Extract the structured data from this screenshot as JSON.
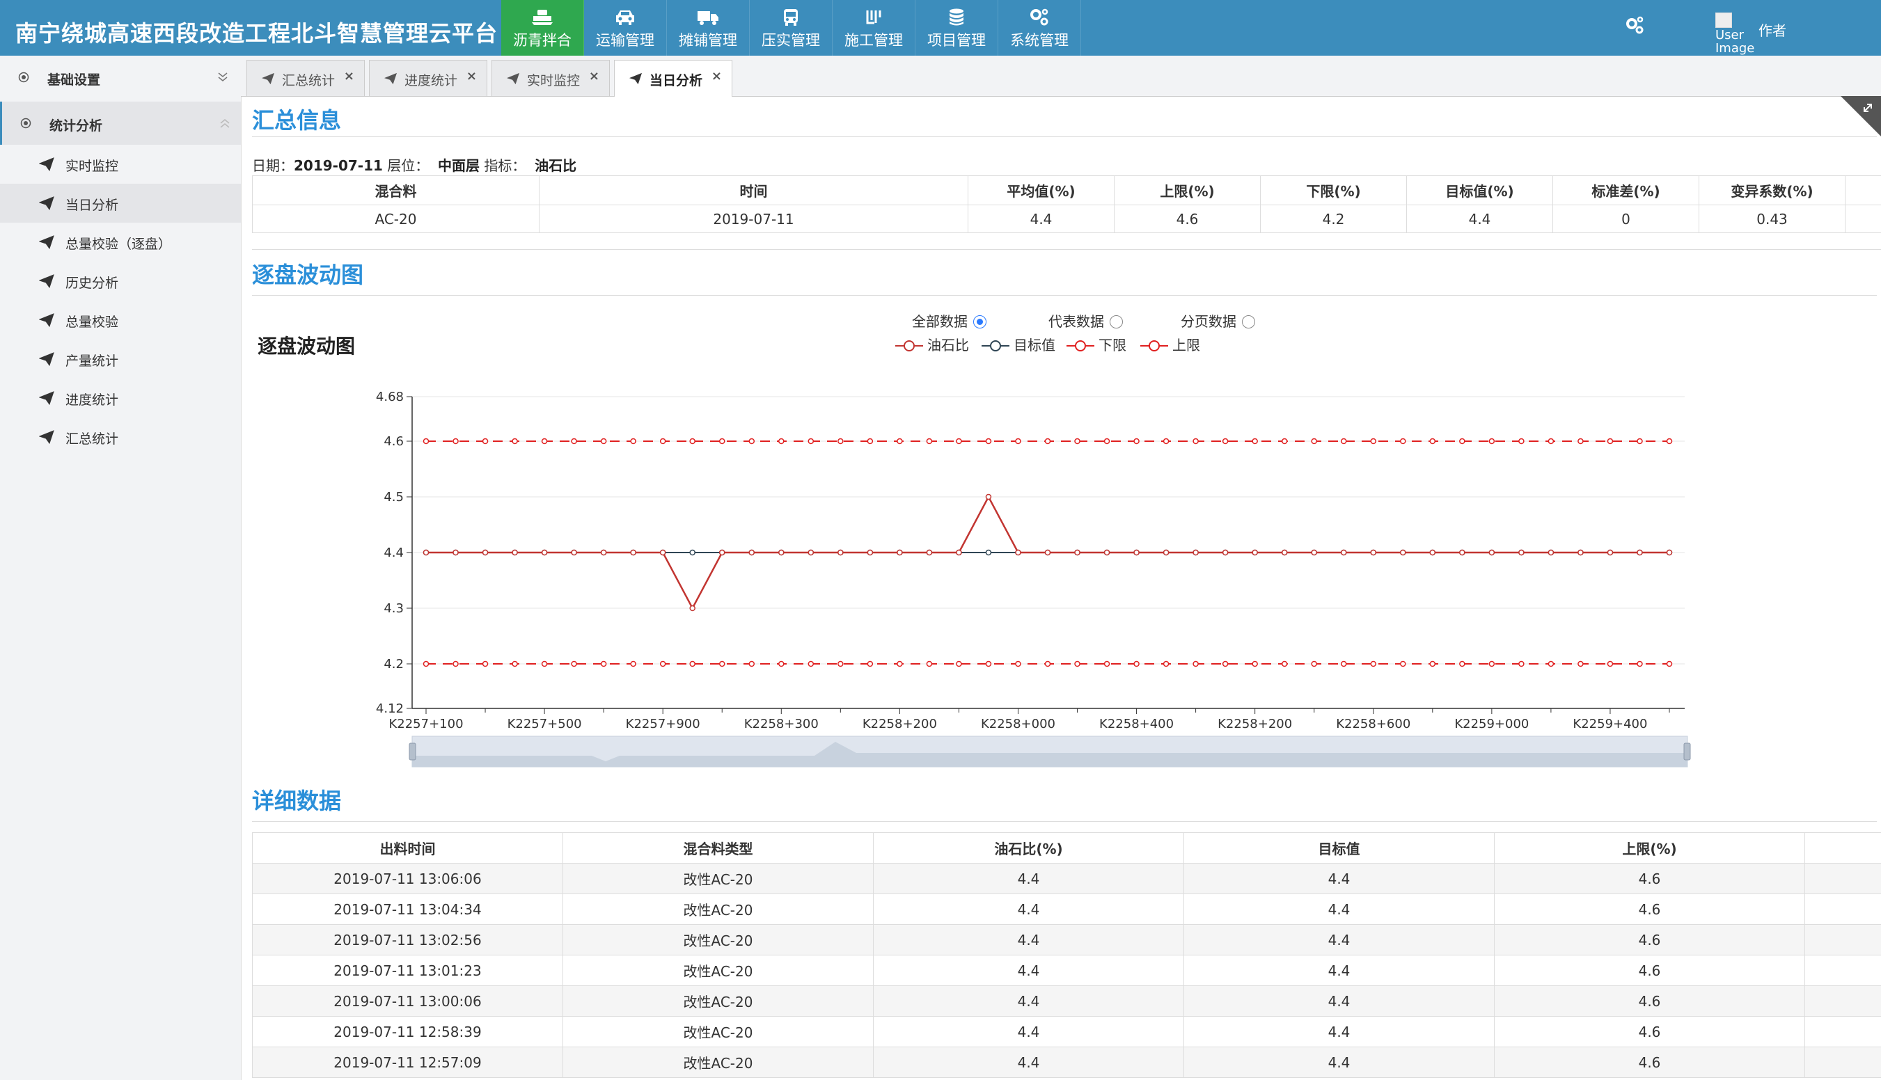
{
  "app": {
    "title": "南宁绕城高速西段改造工程北斗智慧管理云平台",
    "author_label": "作者",
    "user_image_alt": "User Image"
  },
  "nav": [
    {
      "label": "沥青拌合",
      "icon": "plant-icon",
      "active": true
    },
    {
      "label": "运输管理",
      "icon": "car-icon",
      "active": false
    },
    {
      "label": "摊铺管理",
      "icon": "truck-icon",
      "active": false
    },
    {
      "label": "压实管理",
      "icon": "bus-icon",
      "active": false
    },
    {
      "label": "施工管理",
      "icon": "bar-chart-icon",
      "active": false
    },
    {
      "label": "项目管理",
      "icon": "database-icon",
      "active": false
    },
    {
      "label": "系统管理",
      "icon": "gears-icon",
      "active": false
    }
  ],
  "sidebar": {
    "groups": [
      {
        "label": "基础设置",
        "expanded": false
      },
      {
        "label": "统计分析",
        "expanded": true
      }
    ],
    "items": [
      {
        "label": "实时监控"
      },
      {
        "label": "当日分析",
        "active": true
      },
      {
        "label": "总量校验（逐盘）"
      },
      {
        "label": "历史分析"
      },
      {
        "label": "总量校验"
      },
      {
        "label": "产量统计"
      },
      {
        "label": "进度统计"
      },
      {
        "label": "汇总统计"
      }
    ]
  },
  "tabs": [
    {
      "label": "汇总统计",
      "close": "×"
    },
    {
      "label": "进度统计",
      "close": "×"
    },
    {
      "label": "实时监控",
      "close": "×"
    },
    {
      "label": "当日分析",
      "close": "×",
      "active": true
    }
  ],
  "summary": {
    "title": "汇总信息",
    "meta": {
      "date_label": "日期：",
      "date": "2019-07-11",
      "layer_label": "层位：",
      "layer": "中面层",
      "index_label": "指标：",
      "index": "油石比"
    },
    "headers": [
      "混合料",
      "时间",
      "平均值(%)",
      "上限(%)",
      "下限(%)",
      "目标值(%)",
      "标准差(%)",
      "变异系数(%)"
    ],
    "rows": [
      [
        "AC-20",
        "2019-07-11",
        "4.4",
        "4.6",
        "4.2",
        "4.4",
        "0",
        "0.43"
      ]
    ]
  },
  "wave": {
    "section_title": "逐盘波动图",
    "chart_title": "逐盘波动图",
    "radios": [
      {
        "label": "全部数据",
        "checked": true
      },
      {
        "label": "代表数据",
        "checked": false
      },
      {
        "label": "分页数据",
        "checked": false
      }
    ]
  },
  "chart_data": {
    "type": "line",
    "title": "逐盘波动图",
    "ylim": [
      4.12,
      4.68
    ],
    "yticks": [
      "4.68",
      "4.6",
      "4.5",
      "4.4",
      "4.3",
      "4.2",
      "4.12"
    ],
    "ytick_values": [
      4.68,
      4.6,
      4.5,
      4.4,
      4.3,
      4.2,
      4.12
    ],
    "xtick_labels": [
      "K2257+100",
      "K2257+500",
      "K2257+900",
      "K2258+300",
      "K2258+200",
      "K2258+000",
      "K2258+400",
      "K2258+200",
      "K2258+600",
      "K2259+000",
      "K2259+400"
    ],
    "point_count": 43,
    "grid": true,
    "legend": "top",
    "series": [
      {
        "name": "油石比",
        "color": "#c23531",
        "dashed": false,
        "values": [
          4.4,
          4.4,
          4.4,
          4.4,
          4.4,
          4.4,
          4.4,
          4.4,
          4.4,
          4.3,
          4.4,
          4.4,
          4.4,
          4.4,
          4.4,
          4.4,
          4.4,
          4.4,
          4.4,
          4.5,
          4.4,
          4.4,
          4.4,
          4.4,
          4.4,
          4.4,
          4.4,
          4.4,
          4.4,
          4.4,
          4.4,
          4.4,
          4.4,
          4.4,
          4.4,
          4.4,
          4.4,
          4.4,
          4.4,
          4.4,
          4.4,
          4.4,
          4.4
        ]
      },
      {
        "name": "目标值",
        "color": "#2f4554",
        "dashed": false,
        "values": [
          4.4,
          4.4,
          4.4,
          4.4,
          4.4,
          4.4,
          4.4,
          4.4,
          4.4,
          4.4,
          4.4,
          4.4,
          4.4,
          4.4,
          4.4,
          4.4,
          4.4,
          4.4,
          4.4,
          4.4,
          4.4,
          4.4,
          4.4,
          4.4,
          4.4,
          4.4,
          4.4,
          4.4,
          4.4,
          4.4,
          4.4,
          4.4,
          4.4,
          4.4,
          4.4,
          4.4,
          4.4,
          4.4,
          4.4,
          4.4,
          4.4,
          4.4,
          4.4
        ]
      },
      {
        "name": "下限",
        "color": "#e02020",
        "dashed": true,
        "values": [
          4.2,
          4.2,
          4.2,
          4.2,
          4.2,
          4.2,
          4.2,
          4.2,
          4.2,
          4.2,
          4.2,
          4.2,
          4.2,
          4.2,
          4.2,
          4.2,
          4.2,
          4.2,
          4.2,
          4.2,
          4.2,
          4.2,
          4.2,
          4.2,
          4.2,
          4.2,
          4.2,
          4.2,
          4.2,
          4.2,
          4.2,
          4.2,
          4.2,
          4.2,
          4.2,
          4.2,
          4.2,
          4.2,
          4.2,
          4.2,
          4.2,
          4.2,
          4.2
        ]
      },
      {
        "name": "上限",
        "color": "#e02020",
        "dashed": true,
        "values": [
          4.6,
          4.6,
          4.6,
          4.6,
          4.6,
          4.6,
          4.6,
          4.6,
          4.6,
          4.6,
          4.6,
          4.6,
          4.6,
          4.6,
          4.6,
          4.6,
          4.6,
          4.6,
          4.6,
          4.6,
          4.6,
          4.6,
          4.6,
          4.6,
          4.6,
          4.6,
          4.6,
          4.6,
          4.6,
          4.6,
          4.6,
          4.6,
          4.6,
          4.6,
          4.6,
          4.6,
          4.6,
          4.6,
          4.6,
          4.6,
          4.6,
          4.6,
          4.6
        ]
      }
    ]
  },
  "detail": {
    "title": "详细数据",
    "headers": [
      "出料时间",
      "混合料类型",
      "油石比(%)",
      "目标值",
      "上限(%)"
    ],
    "rows": [
      [
        "2019-07-11 13:06:06",
        "改性AC-20",
        "4.4",
        "4.4",
        "4.6"
      ],
      [
        "2019-07-11 13:04:34",
        "改性AC-20",
        "4.4",
        "4.4",
        "4.6"
      ],
      [
        "2019-07-11 13:02:56",
        "改性AC-20",
        "4.4",
        "4.4",
        "4.6"
      ],
      [
        "2019-07-11 13:01:23",
        "改性AC-20",
        "4.4",
        "4.4",
        "4.6"
      ],
      [
        "2019-07-11 13:00:06",
        "改性AC-20",
        "4.4",
        "4.4",
        "4.6"
      ],
      [
        "2019-07-11 12:58:39",
        "改性AC-20",
        "4.4",
        "4.4",
        "4.6"
      ],
      [
        "2019-07-11 12:57:09",
        "改性AC-20",
        "4.4",
        "4.4",
        "4.6"
      ]
    ]
  },
  "colors": {
    "header_bg": "#3c8dbc",
    "active_nav_bg": "#2fa84f",
    "section_title": "#2b8fd9"
  }
}
